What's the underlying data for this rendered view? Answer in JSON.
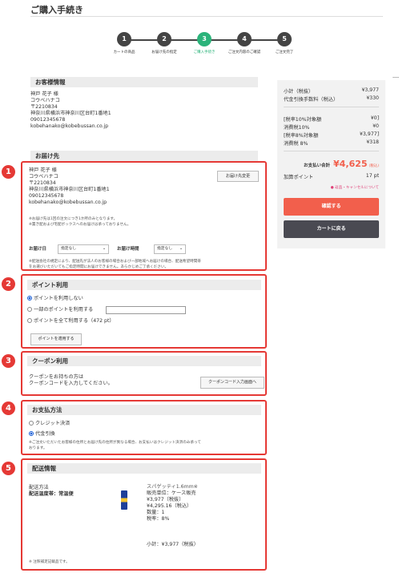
{
  "page": {
    "title": "ご購入手続き"
  },
  "steps": [
    {
      "num": "1",
      "label": "カートの商品"
    },
    {
      "num": "2",
      "label": "お届け先の指定"
    },
    {
      "num": "3",
      "label": "ご購入手続き"
    },
    {
      "num": "4",
      "label": "ご注文内容のご確認"
    },
    {
      "num": "5",
      "label": "ご注文完了"
    }
  ],
  "active_step": 3,
  "customer": {
    "heading": "お客様情報",
    "name": "神戸 花子 様",
    "kana": "コウベハナコ",
    "zip": "〒2210834",
    "address": "神奈川県横浜市神奈川区台町1番地1",
    "phone": "09012345678",
    "email": "kobehanako@kobebussan.co.jp"
  },
  "delivery": {
    "heading": "お届け先",
    "badge": "1",
    "name": "神戸 花子 様",
    "kana": "コウベハナコ",
    "zip": "〒2210834",
    "address": "神奈川県横浜市神奈川区台町1番地1",
    "phone": "09012345678",
    "email": "kobehanako@kobebussan.co.jp",
    "change_button": "お届け先変更",
    "note1": "※お届け先は1回の注文につき1か所のみとなります。",
    "note2": "※置き配および宅配ボックスへのお届けは承っておりません。",
    "date_label": "お届け日",
    "date_value": "指定なし",
    "time_label": "お届け時間",
    "time_value": "指定なし",
    "note3": "※配送会社の規定により、配送先が法人のお客様の場合および一部地域へお届けの場合、配送希望時間帯",
    "note4": "をお選びいただいてもご指定時間にお届けできません。あらかじめご了承ください。"
  },
  "points": {
    "heading": "ポイント利用",
    "badge": "2",
    "opt1": "ポイントを利用しない",
    "opt2": "一部のポイントを利用する",
    "opt3": "ポイントを全て利用する（472 pt）",
    "apply_button": "ポイントを適用する"
  },
  "coupon": {
    "heading": "クーポン利用",
    "badge": "3",
    "text1": "クーポンをお持ちの方は",
    "text2": "クーポンコードを入力してください。",
    "button": "クーポンコード入力画面へ"
  },
  "payment": {
    "heading": "お支払方法",
    "badge": "4",
    "opt1": "クレジット決済",
    "opt2": "代金引換",
    "note": "※ご注文いただいたお客様の住所とお届け先の住所が異なる場合、お支払いはクレジット決済のみ承って",
    "note2": "おります。"
  },
  "shipping": {
    "heading": "配送情報",
    "badge": "5",
    "method_label": "配送方法",
    "temp_label": "配送温度帯：常温便",
    "product_name": "スパゲッティ1.6mm※",
    "unit": "販売単位：ケース販売",
    "price_ex": "¥3,977（税抜）",
    "price_in": "¥4,295.16（税込）",
    "qty": "数量：1",
    "tax": "税率：8%",
    "subtotal": "小計：¥3,977（税抜）",
    "footnote": "※ 注釈補足記載品です。"
  },
  "summary": {
    "subtotal_label": "小計（税抜）",
    "subtotal_value": "¥3,977",
    "cod_label": "代金引換手数料（税込）",
    "cod_value": "¥330",
    "r10_label": "[税率10%対象額",
    "r10_value": "¥0]",
    "t10_label": "消費税10%",
    "t10_value": "¥0",
    "r8_label": "[税率8%対象額",
    "r8_value": "¥3,977]",
    "t8_label": "消費税 8%",
    "t8_value": "¥318",
    "total_label": "お支払い合計",
    "total_value": "¥4,625",
    "total_tax": "(税込)",
    "points_label": "加算ポイント",
    "points_value": "17 pt",
    "cancel_link": "● 返品・キャンセルについて",
    "confirm_button": "確認する",
    "back_button": "カートに戻る"
  },
  "colors": {
    "accent_green": "#2bb37a",
    "alert_red": "#e53935",
    "confirm": "#f25f4c",
    "dark": "#4a4a52"
  }
}
